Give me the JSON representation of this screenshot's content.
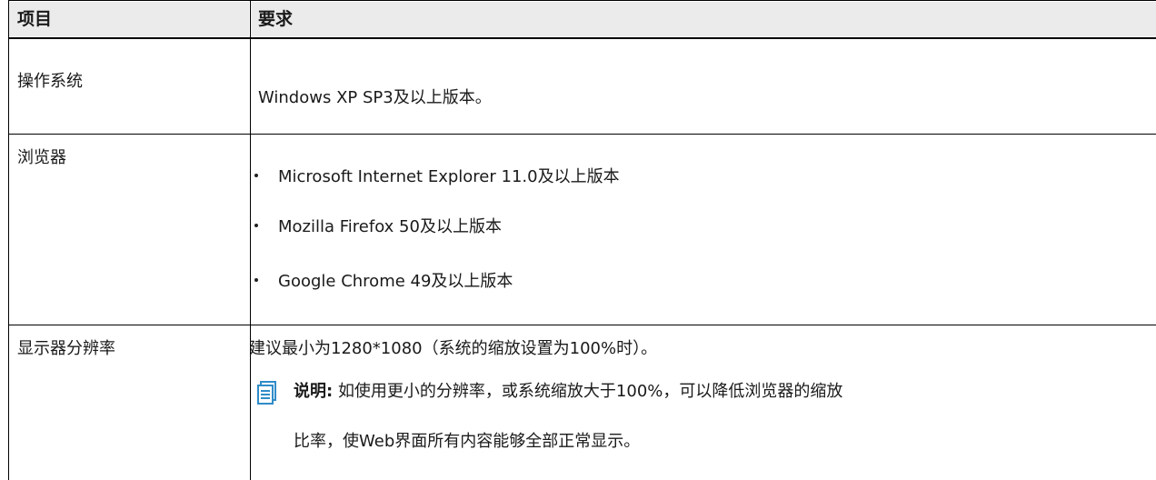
{
  "table": {
    "header": {
      "item": "项目",
      "requirement": "要求"
    },
    "rows": [
      {
        "item": "操作系统",
        "requirement": "Windows XP SP3及以上版本。"
      },
      {
        "item": "浏览器",
        "bullets": [
          "Microsoft Internet Explorer 11.0及以上版本",
          "Mozilla Firefox 50及以上版本",
          "Google Chrome 49及以上版本"
        ]
      },
      {
        "item": "显示器分辨率",
        "requirement": "建议最小为1280*1080（系统的缩放设置为100%时）。",
        "note": {
          "icon": "note-icon",
          "label": "说明:",
          "line1": "如使用更小的分辨率，或系统缩放大于100%，可以降低浏览器的缩放",
          "line2": "比率，使Web界面所有内容能够全部正常显示。"
        }
      }
    ]
  }
}
